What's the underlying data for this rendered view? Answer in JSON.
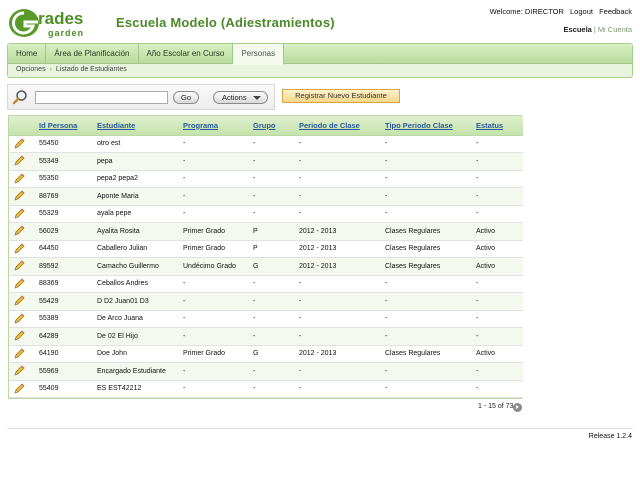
{
  "brand": {
    "logo_text": "Grades garden",
    "school_title": "Escuela Modelo (Adiestramientos)"
  },
  "top_bar": {
    "welcome": "Welcome: DIRECTOR",
    "logout": "Logout",
    "feedback": "Feedback",
    "context_current": "Escuela",
    "context_separator": "|",
    "context_alt": "Mi Cuenta"
  },
  "nav": {
    "tabs": [
      {
        "label": "Home"
      },
      {
        "label": "Área de Planificación"
      },
      {
        "label": "Año Escolar en Curso"
      },
      {
        "label": "Personas"
      }
    ],
    "active_tab": "Personas",
    "breadcrumb": {
      "root": "Opciones",
      "arrow": "›",
      "current": "Listado de Estudiantes"
    }
  },
  "toolbar": {
    "search_value": "",
    "go_label": "Go",
    "actions_label": "Actions",
    "register_label": "Registrar Nuevo Estudiante"
  },
  "table": {
    "columns": [
      "Id Persona",
      "Estudiante",
      "Programa",
      "Grupo",
      "Periodo de Clase",
      "Tipo Periodo Clase",
      "Estatus"
    ],
    "rows": [
      {
        "id": "55450",
        "name": "otro est",
        "programa": "-",
        "grupo": "-",
        "periodo": "-",
        "tipo": "-",
        "estatus": "-"
      },
      {
        "id": "55349",
        "name": "pepa",
        "programa": "-",
        "grupo": "-",
        "periodo": "-",
        "tipo": "-",
        "estatus": "-"
      },
      {
        "id": "55350",
        "name": "pepa2 pepa2",
        "programa": "-",
        "grupo": "-",
        "periodo": "-",
        "tipo": "-",
        "estatus": "-"
      },
      {
        "id": "88769",
        "name": "Aponte Maria",
        "programa": "-",
        "grupo": "-",
        "periodo": "-",
        "tipo": "-",
        "estatus": "-"
      },
      {
        "id": "55329",
        "name": "ayala pepe",
        "programa": "-",
        "grupo": "-",
        "periodo": "-",
        "tipo": "-",
        "estatus": "-"
      },
      {
        "id": "56029",
        "name": "Ayalita Rosita",
        "programa": "Primer Grado",
        "grupo": "P",
        "periodo": "2012 - 2013",
        "tipo": "Clases Regulares",
        "estatus": "Activo"
      },
      {
        "id": "64450",
        "name": "Caballero Julian",
        "programa": "Primer Grado",
        "grupo": "P",
        "periodo": "2012 - 2013",
        "tipo": "Clases Regulares",
        "estatus": "Activo"
      },
      {
        "id": "89592",
        "name": "Camacho Guillermo",
        "programa": "Undécimo Grado",
        "grupo": "G",
        "periodo": "2012 - 2013",
        "tipo": "Clases Regulares",
        "estatus": "Activo"
      },
      {
        "id": "88369",
        "name": "Ceballos Andres",
        "programa": "-",
        "grupo": "-",
        "periodo": "-",
        "tipo": "-",
        "estatus": "-"
      },
      {
        "id": "55429",
        "name": "D D2 Juan01 D3",
        "programa": "-",
        "grupo": "-",
        "periodo": "-",
        "tipo": "-",
        "estatus": "-"
      },
      {
        "id": "55389",
        "name": "De Arco Juana",
        "programa": "-",
        "grupo": "-",
        "periodo": "-",
        "tipo": "-",
        "estatus": "-"
      },
      {
        "id": "64289",
        "name": "De 02 El Hijo",
        "programa": "-",
        "grupo": "-",
        "periodo": "-",
        "tipo": "-",
        "estatus": "-"
      },
      {
        "id": "64190",
        "name": "Doe John",
        "programa": "Primer Grado",
        "grupo": "G",
        "periodo": "2012 - 2013",
        "tipo": "Clases Regulares",
        "estatus": "Activo"
      },
      {
        "id": "55969",
        "name": "Encargado Estudiante",
        "programa": "-",
        "grupo": "-",
        "periodo": "-",
        "tipo": "-",
        "estatus": "-"
      },
      {
        "id": "55409",
        "name": "ES EST42212",
        "programa": "-",
        "grupo": "-",
        "periodo": "-",
        "tipo": "-",
        "estatus": "-"
      }
    ]
  },
  "pagination": {
    "label": "1 - 15 of 73"
  },
  "footer": {
    "release": "Release 1.2.4"
  },
  "icons": {
    "search": "magnifier-icon",
    "edit": "pencil-icon",
    "next": "next-page-icon",
    "dropdown": "chevron-down-icon"
  },
  "colors": {
    "brand_green": "#4a8a2a",
    "nav_green": "#b9dc9c",
    "header_link_blue": "#2a5a9a",
    "register_button": "#f6d78a"
  }
}
